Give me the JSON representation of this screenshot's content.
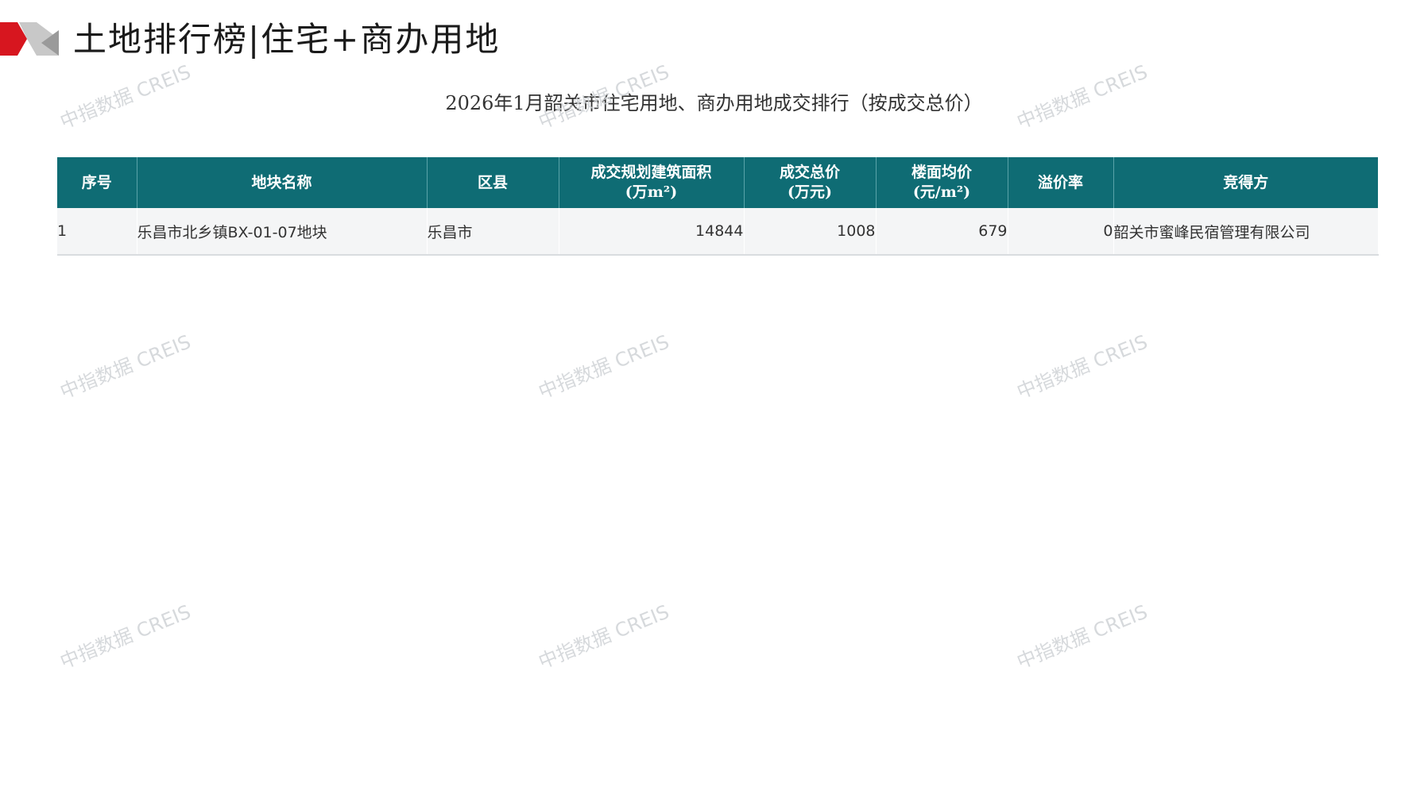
{
  "header": {
    "title_left": "土地排行榜",
    "title_sep": "|",
    "title_right": "住宅+商办用地",
    "logo_colors": {
      "red": "#d7161f",
      "gray": "#9a9a9a",
      "light": "#c8c8c8"
    }
  },
  "table": {
    "title": "2026年1月韶关市住宅用地、商办用地成交排行（按成交总价）",
    "header_color": "#0f6c74",
    "columns": [
      {
        "line1": "序号",
        "line2": ""
      },
      {
        "line1": "地块名称",
        "line2": ""
      },
      {
        "line1": "区县",
        "line2": ""
      },
      {
        "line1": "成交规划建筑面积",
        "line2": "(万m²)"
      },
      {
        "line1": "成交总价",
        "line2": "(万元)"
      },
      {
        "line1": "楼面均价",
        "line2": "(元/m²)"
      },
      {
        "line1": "溢价率",
        "line2": ""
      },
      {
        "line1": "竞得方",
        "line2": ""
      }
    ],
    "rows": [
      {
        "rank": "1",
        "parcel": "乐昌市北乡镇BX-01-07地块",
        "district": "乐昌市",
        "area": "14844",
        "total_price": "1008",
        "unit_price": "679",
        "premium": "0",
        "winner": "韶关市蜜峰民宿管理有限公司"
      }
    ]
  },
  "watermark": {
    "text": "中指数据 CREIS"
  }
}
